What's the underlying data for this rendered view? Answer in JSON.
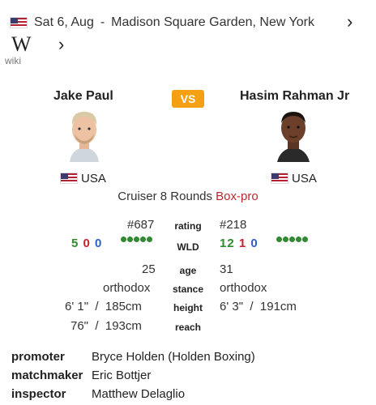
{
  "event": {
    "date": "Sat 6, Aug",
    "separator": "-",
    "venue": "Madison Square Garden, New York",
    "icons": {
      "flag": "us-flag-icon",
      "next": "chevron-right-icon",
      "wiki": "wikipedia-icon"
    },
    "wiki_letter": "W",
    "wiki_label": "wiki"
  },
  "fight": {
    "vs_label": "VS",
    "rounds_text": "Cruiser 8 Rounds",
    "type_text": "Box-pro",
    "accent_colors": {
      "vs": "#f5a012",
      "type": "#c0262d",
      "win": "#2e8b2e",
      "loss": "#c0262d",
      "draw": "#2a62c4"
    }
  },
  "fighters": [
    {
      "name": "Jake Paul",
      "country": "USA",
      "rating": "#687",
      "wld": {
        "w": "5",
        "l": "0",
        "d": "0"
      },
      "form_dots": 5,
      "age": "25",
      "stance": "orthodox",
      "height_imperial": "6' 1\"",
      "height_metric": "185cm",
      "reach_imperial": "76\"",
      "reach_metric": "193cm"
    },
    {
      "name": "Hasim Rahman Jr",
      "country": "USA",
      "rating": "#218",
      "wld": {
        "w": "12",
        "l": "1",
        "d": "0"
      },
      "form_dots": 5,
      "age": "31",
      "stance": "orthodox",
      "height_imperial": "6' 3\"",
      "height_metric": "191cm"
    }
  ],
  "labels": {
    "rating": "rating",
    "wld": "WLD",
    "age": "age",
    "stance": "stance",
    "height": "height",
    "reach": "reach",
    "slash": "/"
  },
  "officials": [
    {
      "role": "promoter",
      "name": "Bryce Holden (Holden Boxing)"
    },
    {
      "role": "matchmaker",
      "name": "Eric Bottjer"
    },
    {
      "role": "inspector",
      "name": "Matthew Delaglio"
    }
  ]
}
